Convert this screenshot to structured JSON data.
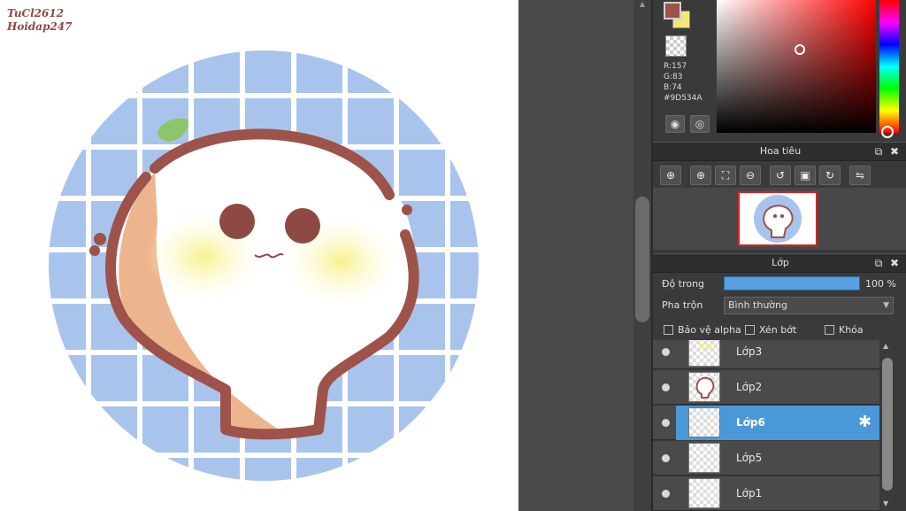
{
  "watermark": {
    "line1": "TuCl2612",
    "line2": "Hoidap247"
  },
  "color": {
    "r": "R:157",
    "g": "G:83",
    "b": "B:74",
    "hex": "#9D534A",
    "foreground": "#9D534A",
    "background": "#F4E77A"
  },
  "navigator": {
    "title": "Hoa tiêu",
    "tools": [
      "zoom-fit-icon",
      "zoom-in-icon",
      "fit-window-icon",
      "zoom-out-icon",
      "rotate-left-icon",
      "fullscreen-icon",
      "rotate-right-icon",
      "flip-icon"
    ]
  },
  "layers": {
    "title": "Lớp",
    "opacity_label": "Độ trong",
    "opacity_value": "100 %",
    "opacity": 1.0,
    "blend_label": "Pha trộn",
    "blend_value": "Bình thường",
    "protect_alpha": "Bảo vệ alpha",
    "clipping": "Xén bớt",
    "lock": "Khóa",
    "items": [
      {
        "name": "Lớp3",
        "selected": false
      },
      {
        "name": "Lớp2",
        "selected": false
      },
      {
        "name": "Lớp6",
        "selected": true
      },
      {
        "name": "Lớp5",
        "selected": false
      },
      {
        "name": "Lớp1",
        "selected": false
      }
    ]
  }
}
